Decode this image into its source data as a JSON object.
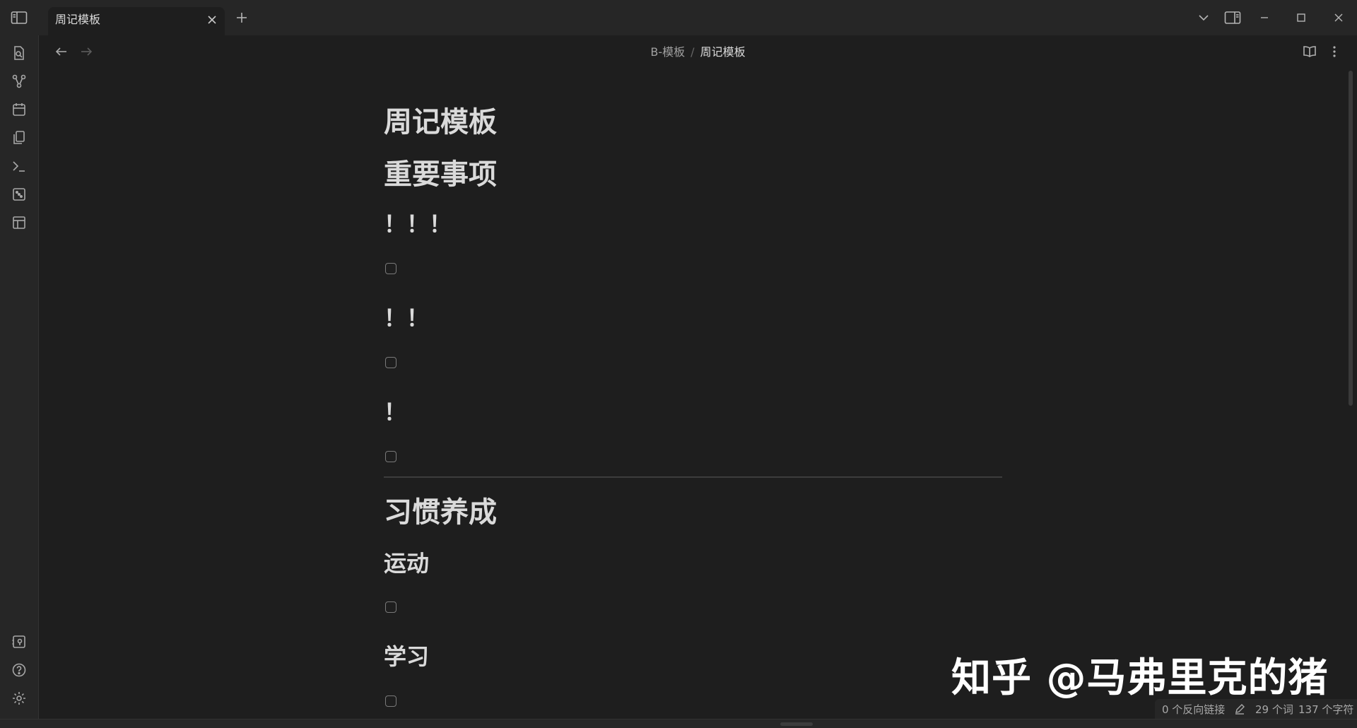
{
  "tab": {
    "title": "周记模板"
  },
  "breadcrumb": {
    "folder": "B-模板",
    "separator": "/",
    "current": "周记模板"
  },
  "note": {
    "title": "周记模板",
    "section1": "重要事项",
    "priority3": "！！！",
    "priority2": "！！",
    "priority1": "！",
    "section2": "习惯养成",
    "habit1": "运动",
    "habit2": "学习"
  },
  "watermark": "知乎 @马弗里克的猪",
  "status": {
    "backlinks": "0 个反向链接",
    "words": "29 个词",
    "chars": "137 个字符"
  },
  "icons": {
    "ribbon_top": [
      "quick-switcher-icon",
      "graph-view-icon",
      "calendar-icon",
      "copy-files-icon",
      "command-palette-icon",
      "random-note-icon",
      "templates-icon"
    ],
    "ribbon_bottom": [
      "vault-switcher-icon",
      "help-icon",
      "settings-icon"
    ]
  }
}
